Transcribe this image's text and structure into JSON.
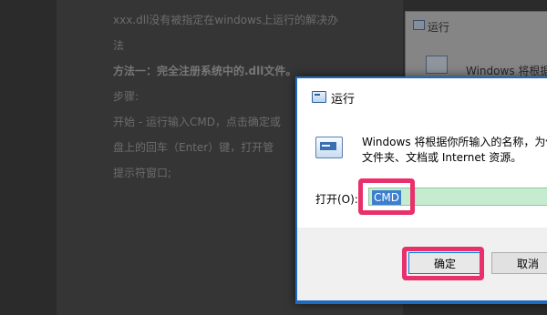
{
  "article": {
    "line1": "xxx.dll没有被指定在windows上运行的解决办",
    "line2": "法",
    "line3": "方法一：完全注册系统中的.dll文件。",
    "line4": "步骤:",
    "line5": "开始 - 运行输入CMD，点击确定或",
    "line6": "盘上的回车（Enter）键，打开管",
    "line7": "提示符窗口;"
  },
  "background_window": {
    "title": "运行",
    "body_text": "Windows 将根据"
  },
  "run_dialog": {
    "title": "运行",
    "prompt_line1": "Windows 将根据你所输入的名称，为你",
    "prompt_line2": "文件夹、文档或 Internet 资源。",
    "open_label": "打开(O):",
    "open_value": "CMD",
    "ok_label": "确定",
    "cancel_label": "取消"
  },
  "colors": {
    "highlight": "#e8306a",
    "dialog_border": "#1c6bc3",
    "input_background": "#c6ecd0",
    "selection": "#3c7fd1"
  },
  "icons": {
    "title_icon": "run-icon",
    "prompt_icon": "run-program-icon"
  }
}
